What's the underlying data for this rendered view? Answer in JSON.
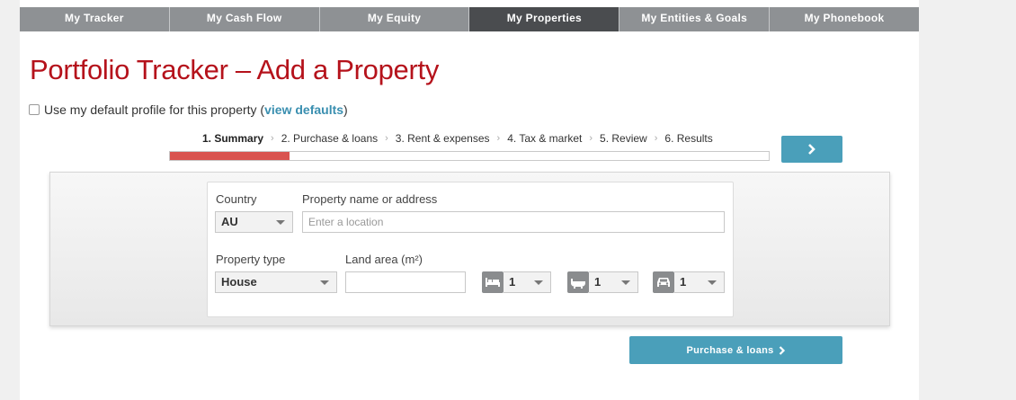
{
  "nav": {
    "tabs": [
      {
        "label": "My Tracker"
      },
      {
        "label": "My Cash Flow"
      },
      {
        "label": "My Equity"
      },
      {
        "label": "My Properties",
        "active": true
      },
      {
        "label": "My Entities & Goals"
      },
      {
        "label": "My Phonebook"
      }
    ]
  },
  "page": {
    "title": "Portfolio Tracker – Add a Property"
  },
  "defaults": {
    "text_before": "Use my default profile for this property (",
    "link": "view defaults",
    "text_after": ")",
    "checked": false
  },
  "steps": {
    "items": [
      {
        "label": "1. Summary",
        "current": true
      },
      {
        "label": "2. Purchase & loans"
      },
      {
        "label": "3. Rent & expenses"
      },
      {
        "label": "4. Tax & market"
      },
      {
        "label": "5. Review"
      },
      {
        "label": "6. Results"
      }
    ],
    "progress_fraction": 0.2
  },
  "form": {
    "country_label": "Country",
    "country_value": "AU",
    "property_label": "Property name or address",
    "property_placeholder": "Enter a location",
    "type_label": "Property type",
    "type_value": "House",
    "land_label": "Land area (m²)",
    "land_value": "",
    "bedrooms": "1",
    "bathrooms": "1",
    "parking": "1"
  },
  "buttons": {
    "next_icon": "chevron-right-icon",
    "purchase_label": "Purchase & loans"
  },
  "colors": {
    "title": "#b5121b",
    "accent": "#4a9fba",
    "nav": "#8e9194",
    "nav_active": "#4a4c4f",
    "progress": "#d9534f"
  }
}
